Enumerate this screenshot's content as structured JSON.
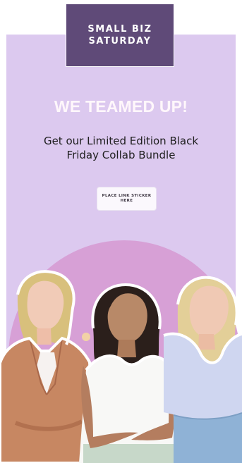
{
  "header": {
    "line1": "SMALL BIZ",
    "line2": "SATURDAY"
  },
  "main": {
    "title": "WE TEAMED UP!",
    "subtitle_line1": "Get our Limited Edition Black",
    "subtitle_line2": "Friday Collab Bundle"
  },
  "sticker": {
    "line1": "PLACE LINK STICKER",
    "line2": "HERE"
  },
  "colors": {
    "card_bg": "#dcc9ef",
    "badge_bg": "#5f4a78",
    "circle": "#d7a0d6",
    "title": "#fff7fb"
  },
  "icons": {
    "illustration": "women-group-illustration"
  }
}
